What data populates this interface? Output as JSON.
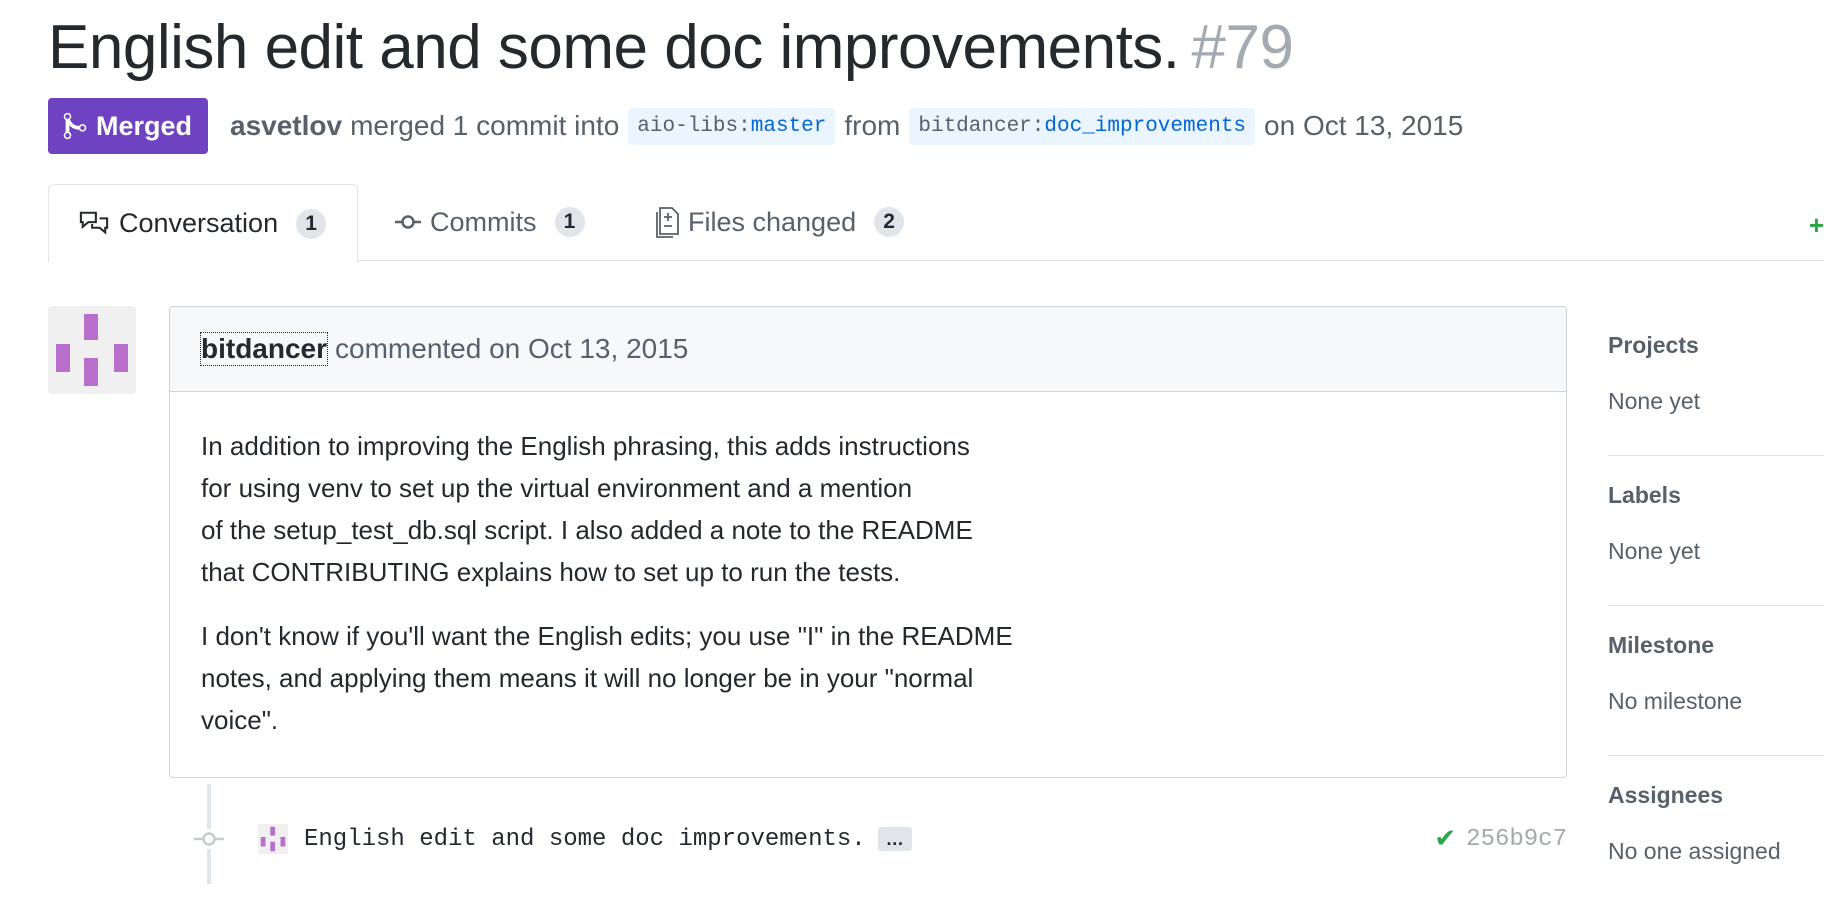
{
  "pr": {
    "title": "English edit and some doc improvements.",
    "number": "#79",
    "state": "Merged",
    "author": "asvetlov",
    "action": "merged 1 commit into",
    "base_repo": "aio-libs",
    "base_branch": "master",
    "from_text": "from",
    "head_repo": "bitdancer",
    "head_branch": "doc_improvements",
    "date_text": "on Oct 13, 2015",
    "branch_separator": ":"
  },
  "tabs": [
    {
      "label": "Conversation",
      "count": "1",
      "icon": "comment-discussion-icon"
    },
    {
      "label": "Commits",
      "count": "1",
      "icon": "git-commit-icon"
    },
    {
      "label": "Files changed",
      "count": "2",
      "icon": "diff-icon"
    }
  ],
  "diffstat": "+",
  "comment": {
    "author": "bitdancer",
    "meta": "commented on Oct 13, 2015",
    "paragraphs": [
      "In addition to improving the English phrasing, this adds instructions\nfor using venv to set up the virtual environment and a mention\nof the setup_test_db.sql script. I also added a note to the README\nthat CONTRIBUTING explains how to set up to run the tests.",
      "I don't know if you'll want the English edits; you use \"I\" in the README\nnotes, and applying them means it will no longer be in your \"normal\nvoice\"."
    ]
  },
  "commit": {
    "message": "English edit and some doc improvements.",
    "ellipsis": "…",
    "status_icon": "check-icon",
    "sha": "256b9c7"
  },
  "sidebar": [
    {
      "title": "Projects",
      "value": "None yet"
    },
    {
      "title": "Labels",
      "value": "None yet"
    },
    {
      "title": "Milestone",
      "value": "No milestone"
    },
    {
      "title": "Assignees",
      "value": "No one assigned"
    }
  ],
  "colors": {
    "merged_purple": "#6f42c1",
    "identicon_purple": "#b970cc",
    "success_green": "#28a745",
    "branch_bg": "#eaf5ff",
    "branch_text": "#0366d6"
  }
}
